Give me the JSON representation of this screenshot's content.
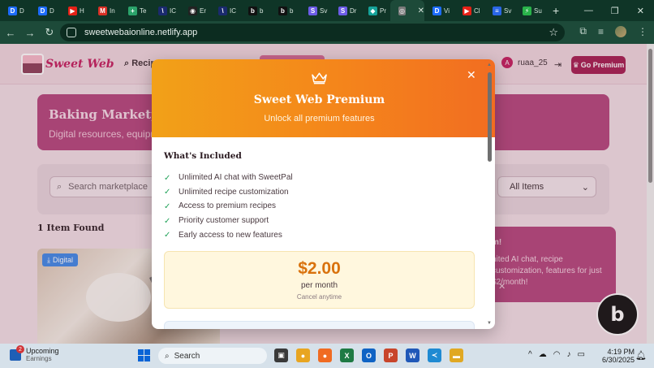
{
  "browser": {
    "tabs": [
      {
        "icon": "D",
        "label": "D",
        "color": "#1d6cff"
      },
      {
        "icon": "D",
        "label": "D",
        "color": "#1d6cff"
      },
      {
        "icon": "▶",
        "label": "H",
        "color": "#e62117"
      },
      {
        "icon": "M",
        "label": "In",
        "color": "#d93025"
      },
      {
        "icon": "+",
        "label": "Te",
        "color": "#2ba36b"
      },
      {
        "icon": "\\",
        "label": "IC",
        "color": "#1a2a6e"
      },
      {
        "icon": "◉",
        "label": "Er",
        "color": "#222222"
      },
      {
        "icon": "\\",
        "label": "IC",
        "color": "#1a2a6e"
      },
      {
        "icon": "b",
        "label": "b",
        "color": "#111111"
      },
      {
        "icon": "b",
        "label": "b",
        "color": "#111111"
      },
      {
        "icon": "S",
        "label": "Sv",
        "color": "#6c5ce7"
      },
      {
        "icon": "S",
        "label": "Dr",
        "color": "#6c5ce7"
      },
      {
        "icon": "◆",
        "label": "Pr",
        "color": "#16a39a"
      },
      {
        "icon": "◎",
        "label": "",
        "color": "#7a7a7a",
        "active": true
      },
      {
        "icon": "D",
        "label": "Vi",
        "color": "#1d6cff"
      },
      {
        "icon": "▶",
        "label": "Cl",
        "color": "#e62117"
      },
      {
        "icon": "≡",
        "label": "Sv",
        "color": "#2a66e6"
      },
      {
        "icon": "⚡",
        "label": "Su",
        "color": "#29b34a"
      }
    ],
    "close_glyph": "✕",
    "new_tab_glyph": "+",
    "window_controls": {
      "minimize": "—",
      "restore": "❐",
      "close": "✕"
    },
    "url": "sweetwebaionline.netlify.app",
    "icons": [
      "back-arrow-icon",
      "forward-arrow-icon",
      "reload-icon",
      "site-info-icon",
      "bookmark-star-icon",
      "cast-icon",
      "media-control-icon",
      "profile-icon",
      "kebab-menu-icon"
    ]
  },
  "app": {
    "logo_text": "Sweet Web",
    "nav_search": "Recip",
    "username": "ruaa_25",
    "avatar_letter": "A",
    "go_premium": "Go Premium",
    "banner_title": "Baking Marketplace",
    "banner_subtitle": "Digital resources, equipm",
    "search_placeholder": "Search marketplace",
    "filter_value": "All Items",
    "found_text": "1 Item Found",
    "badge": "Digital",
    "promo_title": "m!",
    "promo_body": "nited AI chat, recipe customization, features for just $2/month!",
    "promo_close": "✕",
    "bolt_letter": "b"
  },
  "modal": {
    "title": "Sweet Web Premium",
    "subtitle": "Unlock all premium features",
    "close": "✕",
    "included_heading": "What's Included",
    "features": [
      "Unlimited AI chat with SweetPal",
      "Unlimited recipe customization",
      "Access to premium recipes",
      "Priority customer support",
      "Early access to new features"
    ],
    "check_glyph": "✓",
    "price": "$2.00",
    "price_period": "per month",
    "price_note": "Cancel anytime"
  },
  "taskbar": {
    "widget_title": "Upcoming",
    "widget_sub": "Earnings",
    "widget_badge": "2",
    "search_label": "Search",
    "apps": [
      {
        "name": "task-view",
        "glyph": "▣",
        "color": "#3a3a3a"
      },
      {
        "name": "chrome",
        "glyph": "●",
        "color": "#e8a521"
      },
      {
        "name": "firefox",
        "glyph": "●",
        "color": "#f06b22"
      },
      {
        "name": "excel",
        "glyph": "X",
        "color": "#1e7a44"
      },
      {
        "name": "outlook",
        "glyph": "O",
        "color": "#0f63c4"
      },
      {
        "name": "powerpoint",
        "glyph": "P",
        "color": "#c8452b"
      },
      {
        "name": "word",
        "glyph": "W",
        "color": "#2058b8"
      },
      {
        "name": "vscode",
        "glyph": "≺",
        "color": "#1f8ad2"
      },
      {
        "name": "file-explorer",
        "glyph": "▬",
        "color": "#e0a823"
      }
    ],
    "time": "4:19 PM",
    "date": "6/30/2025"
  }
}
